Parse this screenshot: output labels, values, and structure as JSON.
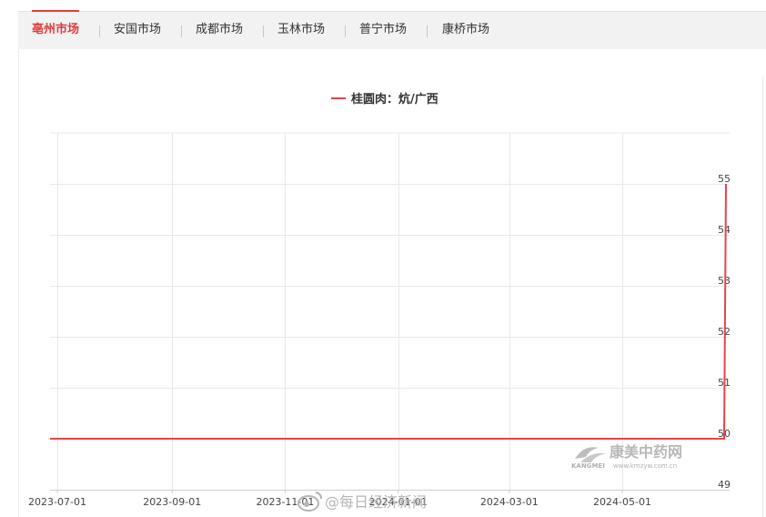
{
  "tabs": [
    {
      "label": "亳州市场",
      "active": true
    },
    {
      "label": "安国市场",
      "active": false
    },
    {
      "label": "成都市场",
      "active": false
    },
    {
      "label": "玉林市场",
      "active": false
    },
    {
      "label": "普宁市场",
      "active": false
    },
    {
      "label": "康桥市场",
      "active": false
    }
  ],
  "colors": {
    "accent": "#e03c3c",
    "series": "#e8434a",
    "grid": "#e8e8e8"
  },
  "chart_data": {
    "type": "line",
    "legend": "桂圆肉：炕/广西",
    "legend_position": "top-center",
    "grid": true,
    "x_ticks": [
      "2023-07-01",
      "2023-09-01",
      "2023-11-01",
      "2024-01-01",
      "2024-03-01",
      "2024-05-01"
    ],
    "y_ticks": [
      49,
      50,
      51,
      52,
      53,
      54,
      55
    ],
    "ylim": [
      49,
      56
    ],
    "y_axis_side": "right",
    "series": [
      {
        "name": "桂圆肉：炕/广西",
        "points": [
          [
            "2023-06-15",
            50
          ],
          [
            "2024-06-25",
            50
          ],
          [
            "2024-06-26",
            55
          ]
        ]
      }
    ]
  },
  "watermarks": {
    "logo_cn": "康美中药网",
    "logo_en": "KANGMEI",
    "logo_url": "www.kmzyw.com.cn",
    "social": "@每日经济新闻"
  }
}
